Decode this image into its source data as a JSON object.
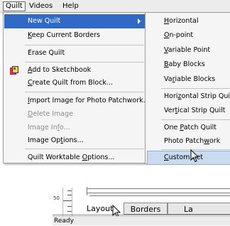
{
  "menubar": {
    "items": [
      {
        "label": "Quilt"
      },
      {
        "label": "Videos"
      },
      {
        "label": "Help"
      }
    ]
  },
  "quilt_menu": {
    "items": [
      {
        "pre": "",
        "u": "",
        "post": "New Quilt",
        "state": "highlighted",
        "has_submenu": true
      },
      {
        "pre": "",
        "u": "K",
        "post": "eep Current Borders",
        "state": "normal"
      },
      {
        "pre": "",
        "u": "",
        "post": "Erase Quilt",
        "state": "normal"
      },
      {
        "pre": "",
        "u": "A",
        "post": "dd to Sketchbook",
        "state": "normal",
        "icon": "sketchbook-icon"
      },
      {
        "pre": "",
        "u": "C",
        "post": "reate Quilt from Block...",
        "state": "normal"
      },
      {
        "pre": "",
        "u": "I",
        "post": "mport Image for Photo Patchwork...",
        "state": "normal"
      },
      {
        "pre": "",
        "u": "D",
        "post": "elete Image",
        "state": "disabled"
      },
      {
        "pre": "Image In",
        "u": "f",
        "post": "o...",
        "state": "disabled"
      },
      {
        "pre": "Image Op",
        "u": "t",
        "post": "ions...",
        "state": "normal"
      },
      {
        "pre": "Quilt Worktable ",
        "u": "O",
        "post": "ptions...",
        "state": "normal"
      }
    ]
  },
  "new_quilt_submenu": {
    "items": [
      {
        "pre": "",
        "u": "H",
        "post": "orizontal",
        "state": "normal"
      },
      {
        "pre": "",
        "u": "O",
        "post": "n-point",
        "state": "normal"
      },
      {
        "pre": "",
        "u": "V",
        "post": "ariable Point",
        "state": "normal"
      },
      {
        "pre": "",
        "u": "B",
        "post": "aby Blocks",
        "state": "normal"
      },
      {
        "pre": "Va",
        "u": "r",
        "post": "iable Blocks",
        "state": "normal"
      },
      {
        "pre": "Hori",
        "u": "z",
        "post": "ontal Strip Quilt",
        "state": "normal"
      },
      {
        "pre": "Ver",
        "u": "t",
        "post": "ical Strip Quilt",
        "state": "normal"
      },
      {
        "pre": "One ",
        "u": "P",
        "post": "atch Quilt",
        "state": "normal"
      },
      {
        "pre": "Photo Patch",
        "u": "w",
        "post": "ork",
        "state": "normal"
      },
      {
        "pre": "",
        "u": "C",
        "post": "ustom Set",
        "state": "highlighted"
      }
    ]
  },
  "worktable": {
    "ruler_label": "50",
    "tabs": [
      {
        "label": "Layout",
        "state": "active"
      },
      {
        "label": "Borders",
        "state": "inactive"
      },
      {
        "label": "La",
        "state": "inactive"
      }
    ]
  },
  "status": {
    "text": "Ready"
  },
  "colors": {
    "menu_highlight": "#316ac5",
    "submenu_highlight": "#c9daf1",
    "disabled_text": "#8c8c8c"
  }
}
